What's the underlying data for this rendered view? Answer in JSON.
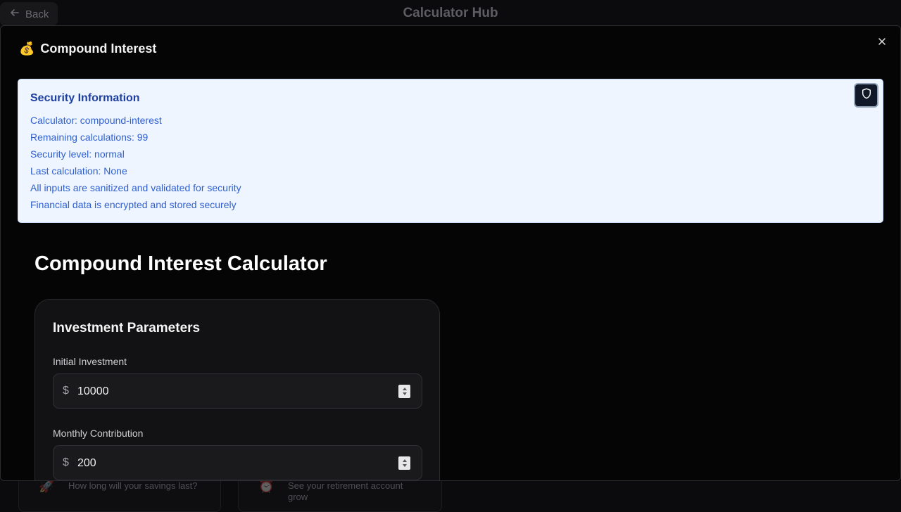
{
  "background": {
    "back_label": "Back",
    "app_title": "Calculator Hub",
    "cards": [
      {
        "desc": "How long will your savings last?"
      },
      {
        "desc": "See your retirement account grow"
      }
    ]
  },
  "modal": {
    "emoji": "💰",
    "title": "Compound Interest",
    "security": {
      "heading": "Security Information",
      "lines": [
        "Calculator: compound-interest",
        "Remaining calculations: 99",
        "Security level: normal",
        "Last calculation: None",
        "All inputs are sanitized and validated for security",
        "Financial data is encrypted and stored securely"
      ]
    },
    "calculator_title": "Compound Interest Calculator",
    "params": {
      "title": "Investment Parameters",
      "fields": [
        {
          "label": "Initial Investment",
          "prefix": "$",
          "value": "10000"
        },
        {
          "label": "Monthly Contribution",
          "prefix": "$",
          "value": "200"
        }
      ]
    }
  }
}
